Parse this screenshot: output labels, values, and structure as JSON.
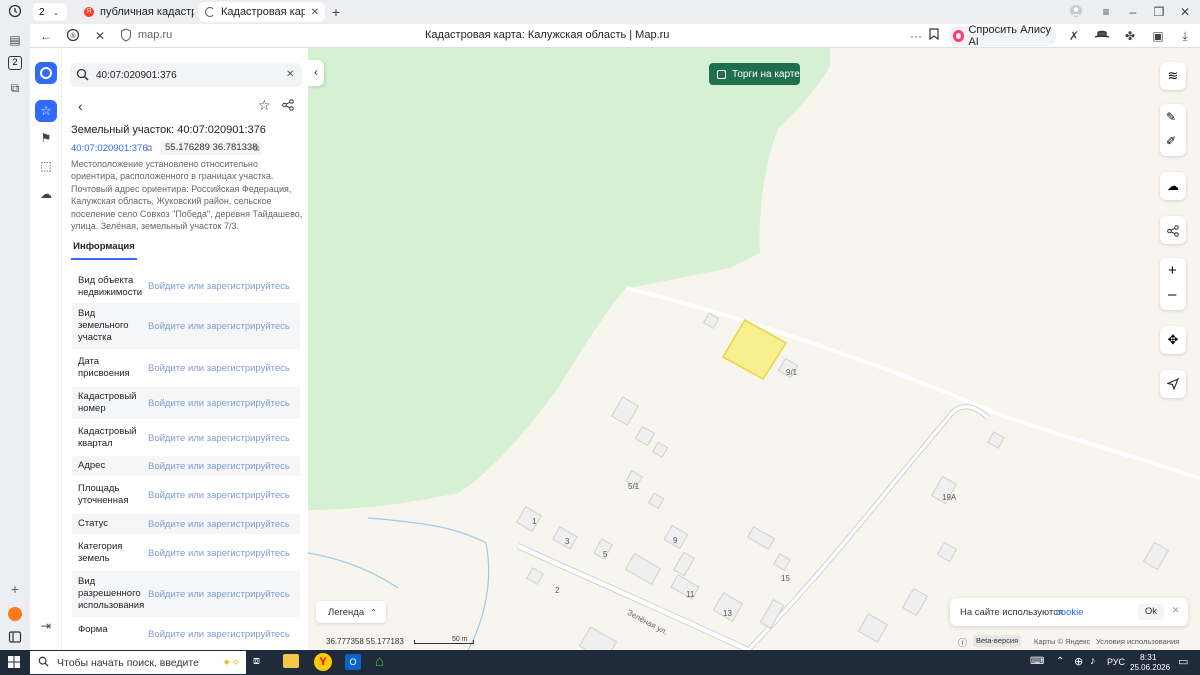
{
  "browser": {
    "tab_counter": "2",
    "tabs": [
      {
        "title": "публичная кадастровая к"
      },
      {
        "title": "Кадастровая карта: Ка"
      }
    ],
    "url": "map.ru",
    "page_title": "Кадастровая карта: Калужская область | Map.ru",
    "alice_label": "Спросить Алису AI",
    "side_badge": "2"
  },
  "app": {
    "search_value": "40:07:020901:376",
    "parcel_title": "Земельный участок: 40:07:020901:376",
    "cadastral_number": "40:07:020901:376",
    "coordinates": "55.176289 36.781338",
    "description": "Местоположение установлено относительно ориентира, расположенного в границах участка. Почтовый адрес ориентира: Российская Федерация, Калужская область, Жуковский район, сельское поселение село Совхоз \"Победа\", деревня Тайдашево, улица. Зелёная, земельный участок 7/3.",
    "tab_info": "Информация",
    "login_text": "Войдите или зарегистрируйтесь",
    "info_rows": [
      {
        "label": "Вид объекта недвижимости"
      },
      {
        "label": "Вид земельного участка"
      },
      {
        "label": "Дата присвоения"
      },
      {
        "label": "Кадастровый номер"
      },
      {
        "label": "Кадастровый квартал"
      },
      {
        "label": "Адрес"
      },
      {
        "label": "Площадь уточненная"
      },
      {
        "label": "Статус"
      },
      {
        "label": "Категория земель"
      },
      {
        "label": "Вид разрешенного использования"
      },
      {
        "label": "Форма"
      }
    ]
  },
  "map": {
    "auction_button": "Торги на карте",
    "legend_button": "Легенда",
    "coord_lon": "36.777358",
    "coord_lat": "55.177183",
    "scale_label": "50 m",
    "beta_label": "Beta-версия",
    "copyright": "Карты © Яндекс",
    "terms": "Условия использования",
    "cookie_text": "На сайте используются",
    "cookie_link": "cookie",
    "cookie_ok": "Ok",
    "street_label": "Зелёная ул.",
    "house_labels": [
      "9/1",
      "5/1",
      "19А",
      "1",
      "3",
      "5",
      "9",
      "2",
      "11",
      "13",
      "15"
    ]
  },
  "taskbar": {
    "search_placeholder": "Чтобы начать поиск, введите",
    "language": "РУС",
    "time": "8:31",
    "date": "25.06.2026"
  },
  "colors": {
    "forest": "#d6f0d3",
    "parcel_fill": "#f8ef8e",
    "parcel_stroke": "#e9d442",
    "auction_bg": "#1f6e4c",
    "accent": "#2f6bff",
    "link": "#7f9bd6"
  }
}
